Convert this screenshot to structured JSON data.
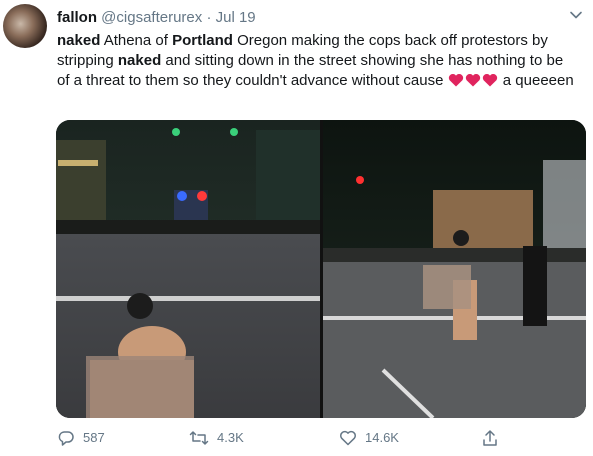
{
  "tweet": {
    "author_name": "fallon",
    "author_handle": "@cigsafterurex",
    "separator": "·",
    "date": "Jul 19",
    "text_parts": [
      {
        "bold": true,
        "text": "naked"
      },
      {
        "bold": false,
        "text": " Athena of "
      },
      {
        "bold": true,
        "text": "Portland"
      },
      {
        "bold": false,
        "text": " Oregon  making the cops back off protestors by stripping "
      },
      {
        "bold": true,
        "text": "naked"
      },
      {
        "bold": false,
        "text": " and sitting down in the street showing she has nothing to be of a threat to them so they couldn't advance without cause "
      },
      {
        "bold": false,
        "text": " a queeeen"
      }
    ],
    "hearts_color": "#e0245e"
  },
  "actions": {
    "reply_count": "587",
    "retweet_count": "4.3K",
    "like_count": "14.6K"
  },
  "icons": {
    "reply": "reply-icon",
    "retweet": "retweet-icon",
    "like": "like-icon",
    "share": "share-icon",
    "caret": "chevron-down-icon"
  }
}
